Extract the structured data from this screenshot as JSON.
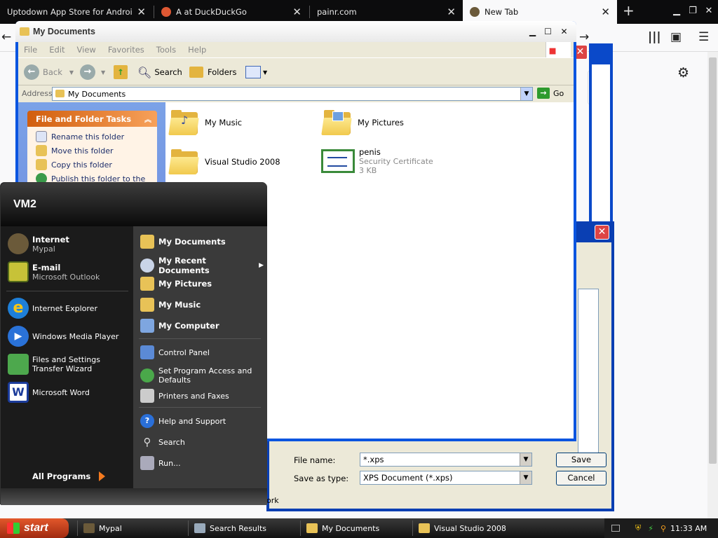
{
  "browser": {
    "tabs": [
      {
        "title": "Uptodown App Store for Android"
      },
      {
        "title": "A at DuckDuckGo"
      },
      {
        "title": "painr.com"
      },
      {
        "title": "New Tab"
      }
    ]
  },
  "explorer": {
    "title": "My Documents",
    "menu": [
      "File",
      "Edit",
      "View",
      "Favorites",
      "Tools",
      "Help"
    ],
    "toolbar": {
      "back": "Back",
      "search": "Search",
      "folders": "Folders"
    },
    "address_label": "Address",
    "address_value": "My Documents",
    "go_label": "Go",
    "tasks": {
      "heading": "File and Folder Tasks",
      "items": [
        "Rename this folder",
        "Move this folder",
        "Copy this folder",
        "Publish this folder to the"
      ]
    },
    "files": [
      {
        "name": "My Music"
      },
      {
        "name": "My Pictures"
      },
      {
        "name": "Visual Studio 2008"
      },
      {
        "name": "penis",
        "type": "Security Certificate",
        "size": "3 KB"
      }
    ]
  },
  "save_dialog": {
    "file_name_label": "File name:",
    "file_name_value": "*.xps",
    "save_as_label": "Save as type:",
    "save_as_value": "XPS Document (*.xps)",
    "save_button": "Save",
    "cancel_button": "Cancel",
    "side_text": "ork"
  },
  "start_menu": {
    "user": "VM2",
    "pinned": [
      {
        "title": "Internet",
        "subtitle": "Mypal"
      },
      {
        "title": "E-mail",
        "subtitle": "Microsoft Outlook"
      }
    ],
    "recent": [
      "Internet Explorer",
      "Windows Media Player",
      "Files and Settings Transfer Wizard",
      "Microsoft Word"
    ],
    "all_programs": "All Programs",
    "right_bold": [
      "My Documents",
      "My Recent Documents",
      "My Pictures",
      "My Music",
      "My Computer"
    ],
    "right_items": [
      "Control Panel",
      "Set Program Access and Defaults",
      "Printers and Faxes",
      "Help and Support",
      "Search",
      "Run..."
    ]
  },
  "taskbar": {
    "start": "start",
    "items": [
      "Mypal",
      "Search Results",
      "My Documents",
      "Visual Studio 2008"
    ],
    "clock": "11:33 AM"
  }
}
